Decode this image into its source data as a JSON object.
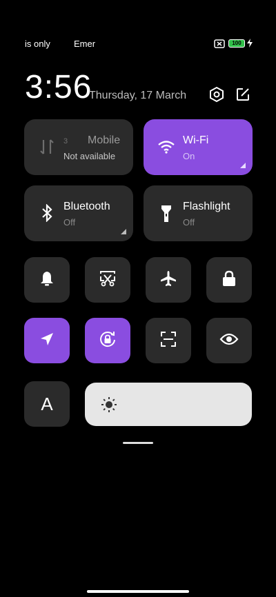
{
  "status_bar": {
    "left_text": "is only",
    "middle_text": "Emer",
    "battery_level": "100"
  },
  "header": {
    "time": "3:56",
    "date": "Thursday, 17 March",
    "icons": [
      "settings-hex-icon",
      "edit-icon"
    ]
  },
  "tiles": {
    "mobile": {
      "title": "Mobile",
      "subtitle": "Not available",
      "badge": "3",
      "active": false
    },
    "wifi": {
      "title": "Wi-Fi",
      "subtitle": "On",
      "active": true
    },
    "bluetooth": {
      "title": "Bluetooth",
      "subtitle": "Off",
      "active": false
    },
    "flashlight": {
      "title": "Flashlight",
      "subtitle": "Off",
      "active": false
    }
  },
  "toggles_row1": [
    "bell-icon",
    "screenshot-cut-icon",
    "airplane-icon",
    "lock-icon"
  ],
  "toggles_row2": [
    "location-arrow-icon",
    "rotation-lock-icon",
    "scan-icon",
    "eye-icon"
  ],
  "font_button_label": "A",
  "colors": {
    "accent": "#8a4de0",
    "tile": "#2b2b2b",
    "background": "#000000"
  }
}
